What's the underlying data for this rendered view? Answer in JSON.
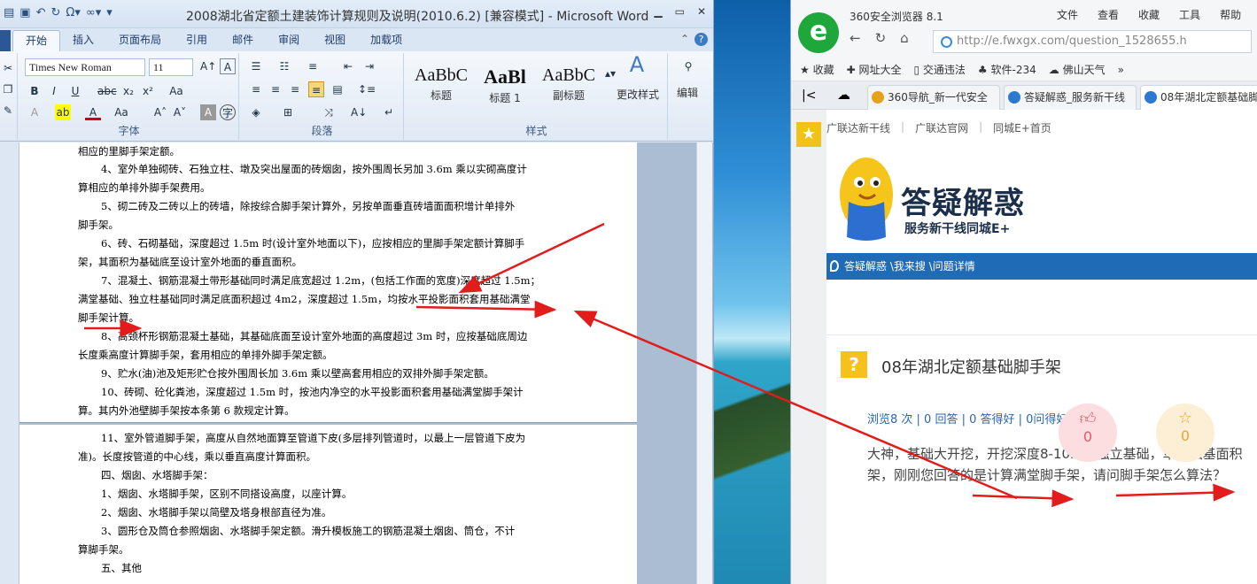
{
  "word": {
    "title": "2008湖北省定额土建装饰计算规则及说明(2010.6.2) [兼容模式] - Microsoft Word",
    "qa_icons": [
      "save-icon",
      "undo-icon",
      "redo-icon",
      "omega-icon",
      "link-icon"
    ],
    "tabs": [
      "开始",
      "插入",
      "页面布局",
      "引用",
      "邮件",
      "审阅",
      "视图",
      "加载项"
    ],
    "active_tab": "开始",
    "font_name": "Times New Roman",
    "font_size": "11",
    "groups": {
      "font": "字体",
      "paragraph": "段落",
      "styles": "样式"
    },
    "styles": [
      {
        "preview": "AaBbC",
        "label": "标题"
      },
      {
        "preview": "AaBl",
        "label": "标题 1"
      },
      {
        "preview": "AaBbC",
        "label": "副标题"
      }
    ],
    "change_styles": "更改样式",
    "edit": "编辑",
    "lines": [
      "相应的里脚手架定额。",
      "4、室外单独砌砖、石独立柱、墩及突出屋面的砖烟囱，按外围周长另加 3.6m 乘以实砌高度计",
      "算相应的单排外脚手架费用。",
      "5、砌二砖及二砖以上的砖墙，除按综合脚手架计算外，另按单面垂直砖墙面面积增计单排外",
      "脚手架。",
      "6、砖、石砌基础，深度超过 1.5m 时(设计室外地面以下)，应按相应的里脚手架定额计算脚手",
      "架，其面积为基础底至设计室外地面的垂直面积。",
      "7、混凝土、钢筋混凝土带形基础同时满足底宽超过 1.2m，(包括工作面的宽度)深度超过 1.5m；",
      "满堂基础、独立柱基础同时满足底面积超过 4m2，深度超过 1.5m，均按水平投影面积套用基础满堂",
      "脚手架计算。",
      "8、高颈杯形钢筋混凝土基础，其基础底面至设计室外地面的高度超过 3m 时，应按基础底周边",
      "长度乘高度计算脚手架，套用相应的单排外脚手架定额。",
      "9、贮水(油)池及矩形贮仓按外围周长加 3.6m 乘以壁高套用相应的双排外脚手架定额。",
      "10、砖砌、砼化粪池，深度超过 1.5m 时，按池内净空的水平投影面积套用基础满堂脚手架计",
      "算。其内外池壁脚手架按本条第 6 款规定计算。",
      "11、室外管道脚手架，高度从自然地面算至管道下皮(多层排列管道时，以最上一层管道下皮为",
      "准)。长度按管道的中心线，乘以垂直高度计算面积。",
      "四、烟囱、水塔脚手架：",
      "1、烟囱、水塔脚手架，区别不同搭设高度，以座计算。",
      "2、烟囱、水塔脚手架以简壁及塔身根部直径为准。",
      "3、圆形仓及筒仓参照烟囱、水塔脚手架定额。滑升模板施工的钢筋混凝土烟囱、筒仓，不计",
      "算脚手架。",
      "五、其他"
    ]
  },
  "browser": {
    "name": "360安全浏览器 8.1",
    "menu": [
      "文件",
      "查看",
      "收藏",
      "工具",
      "帮助"
    ],
    "url": "http://e.fwxgx.com/question_1528655.h",
    "bookmarks": [
      "收藏",
      "网址大全",
      "交通违法",
      "软件-234",
      "佛山天气"
    ],
    "tabs": [
      "360导航_新一代安全",
      "答疑解惑_服务新干线",
      "08年湖北定额基础脚手"
    ],
    "active_tab_index": 2,
    "site": {
      "top_links": [
        "广联达新干线",
        "广联达官网",
        "同城E+首页"
      ],
      "brand": "答疑解惑",
      "slogan": "服务新干线同城E+",
      "breadcrumb": "答疑解惑 \\我来搜 \\问题详情",
      "question_title": "08年湖北定额基础脚手架",
      "stats": "浏览8 次 | 0 回答 | 0 答得好 | 0问得好",
      "question_text_1": "大神，基础大开挖，开挖深度8-10m，独立基础，单个独基面积",
      "question_text_2": "架，刚刚您回答的是计算满堂脚手架，请问脚手架怎么算法？",
      "like_count": "0",
      "fav_count": "0"
    }
  },
  "annotation_color": "#e21b1b"
}
